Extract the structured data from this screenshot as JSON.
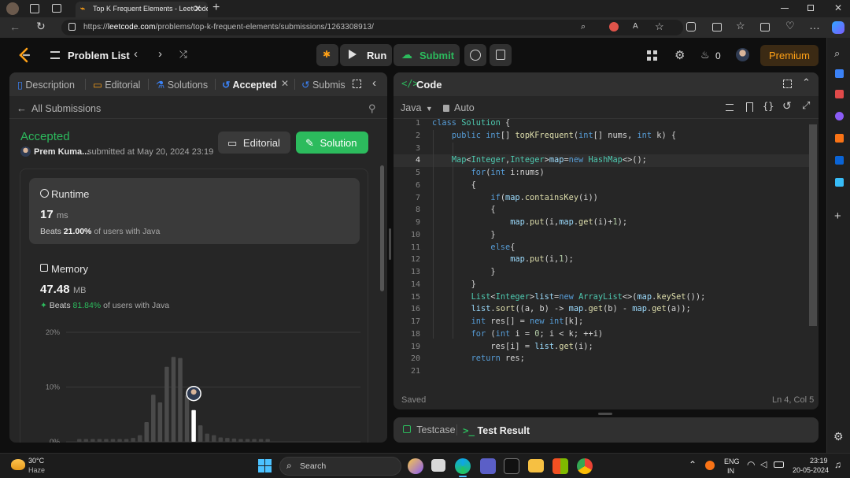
{
  "browser": {
    "tab_title": "Top K Frequent Elements - LeetCode",
    "url_host": "leetcode.com",
    "url_path": "/problems/top-k-frequent-elements/submissions/1263308913/",
    "url_scheme": "https://"
  },
  "nav": {
    "problem_list": "Problem List",
    "run": "Run",
    "submit": "Submit",
    "streak": "0",
    "premium": "Premium"
  },
  "left_tabs": [
    {
      "label": "Description"
    },
    {
      "label": "Editorial"
    },
    {
      "label": "Solutions"
    },
    {
      "label": "Accepted"
    },
    {
      "label": "Submis"
    }
  ],
  "submission": {
    "back_label": "All Submissions",
    "status": "Accepted",
    "user": "Prem Kuma...",
    "submitted_at": "submitted at May 20, 2024 23:19",
    "editorial_btn": "Editorial",
    "solution_btn": "Solution",
    "runtime": {
      "title": "Runtime",
      "value": "17",
      "unit": "ms",
      "beats_prefix": "Beats",
      "beats": "21.00%",
      "beats_suffix": "of users with Java"
    },
    "memory": {
      "title": "Memory",
      "value": "47.48",
      "unit": "MB",
      "beats_prefix": "Beats",
      "beats": "81.84%",
      "beats_suffix": "of users with Java"
    }
  },
  "chart_data": {
    "type": "bar",
    "yticks": [
      "20%",
      "10%",
      "0%"
    ],
    "ylim": [
      0,
      20
    ],
    "values": [
      0.5,
      0.5,
      0.5,
      0.5,
      0.5,
      0.5,
      0.5,
      0.5,
      0.7,
      1.2,
      3.6,
      8.6,
      7.2,
      13.7,
      15.5,
      15.3,
      8.5,
      5.8,
      3.0,
      1.5,
      1.2,
      0.8,
      0.7,
      0.6,
      0.5,
      0.5,
      0.5,
      0.5,
      0.5
    ],
    "highlight_index": 17
  },
  "code_panel": {
    "title": "Code",
    "language": "Java",
    "mode": "Auto",
    "status": "Saved",
    "cursor": "Ln 4, Col 5",
    "lines": [
      "class Solution {",
      "    public int[] topKFrequent(int[] nums, int k) {",
      "",
      "    Map<Integer,Integer>map=new HashMap<>();",
      "        for(int i:nums)",
      "        {",
      "            if(map.containsKey(i))",
      "            {",
      "                map.put(i,map.get(i)+1);",
      "            }",
      "            else{",
      "                map.put(i,1);",
      "            }",
      "        }",
      "        List<Integer>list=new ArrayList<>(map.keySet());",
      "        list.sort((a, b) -> map.get(b) - map.get(a));",
      "        int res[] = new int[k];",
      "        for (int i = 0; i < k; ++i)",
      "            res[i] = list.get(i);",
      "        return res;",
      ""
    ]
  },
  "bottom_tabs": {
    "testcase": "Testcase",
    "test_result": "Test Result"
  },
  "taskbar": {
    "weather_temp": "30°C",
    "weather_desc": "Haze",
    "search": "Search",
    "lang": "ENG",
    "region": "IN",
    "time": "23:19",
    "date": "20-05-2024"
  },
  "colors": {
    "green": "#2cbb5d",
    "accent_orange": "#ffa116",
    "premium_bg": "#3b2a14",
    "chart_bar": "#4a4a4a"
  }
}
